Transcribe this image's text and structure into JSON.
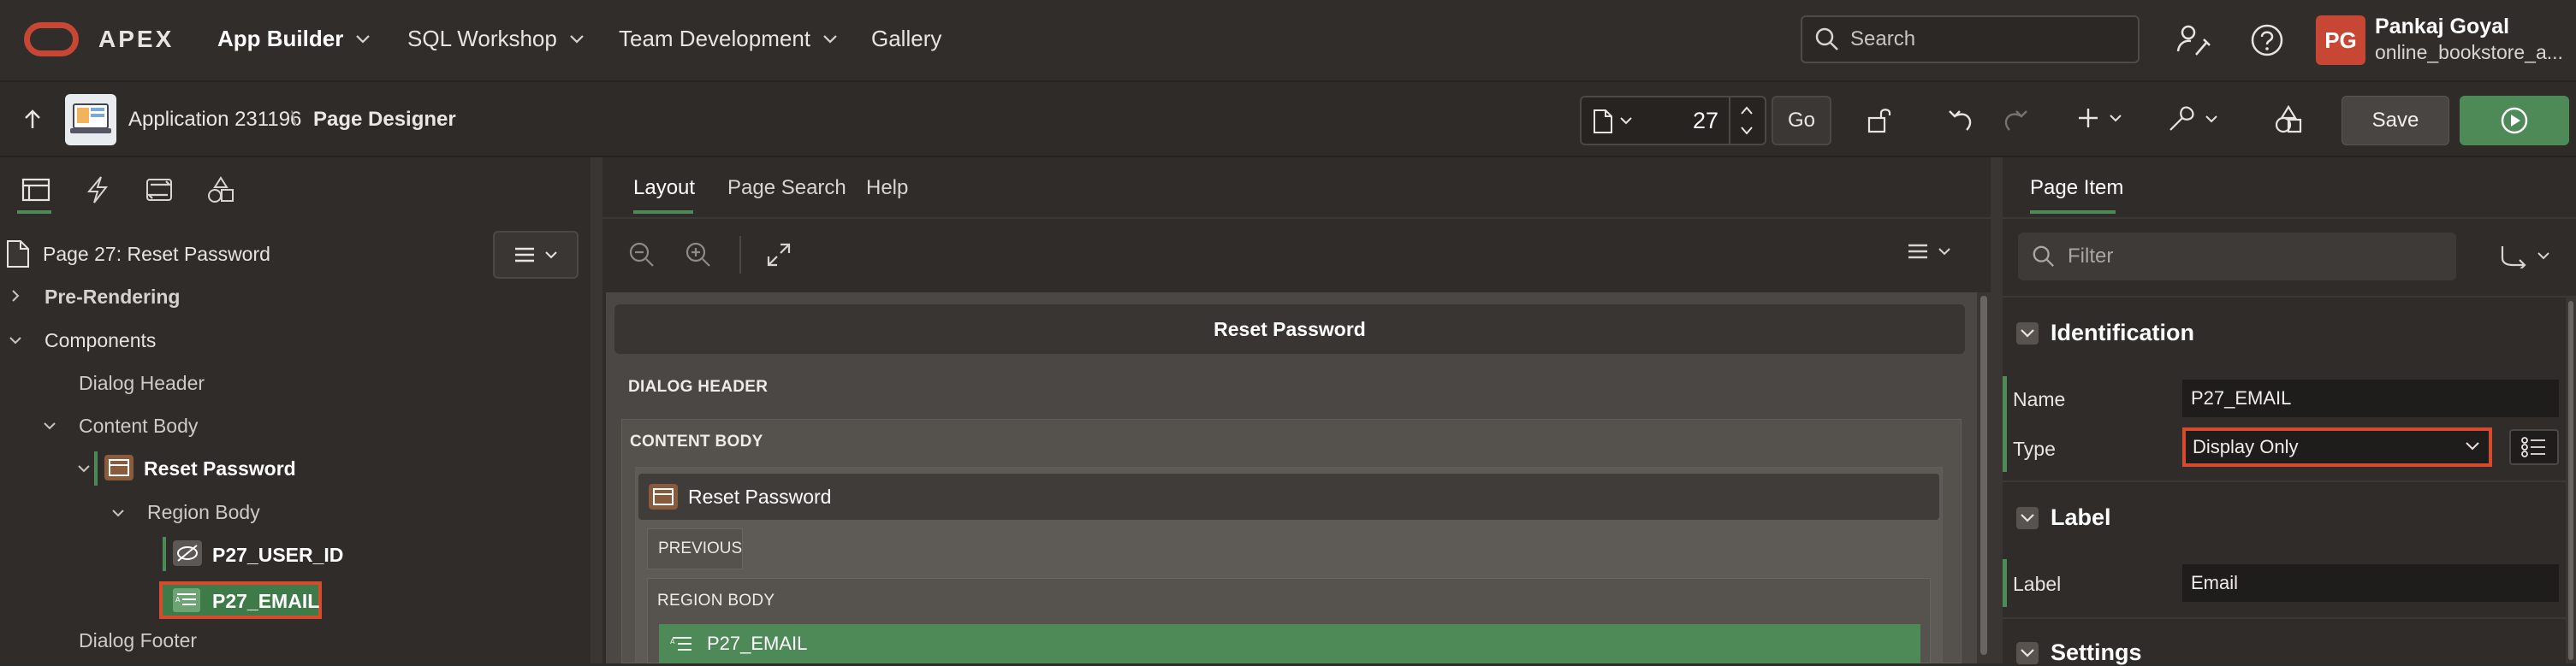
{
  "app": {
    "name": "APEX"
  },
  "nav": {
    "items": [
      "App Builder",
      "SQL Workshop",
      "Team Development",
      "Gallery"
    ]
  },
  "search": {
    "placeholder": "Search"
  },
  "user": {
    "initials": "PG",
    "name": "Pankaj Goyal",
    "workspace": "online_bookstore_a..."
  },
  "breadcrumb": {
    "application": "Application 231196",
    "separator": "\\",
    "page": "Page Designer"
  },
  "toolbar": {
    "page_number": "27",
    "go": "Go",
    "save": "Save"
  },
  "left_panel": {
    "page_title": "Page 27: Reset Password",
    "tree": [
      {
        "label": "Pre-Rendering",
        "bold": true
      },
      {
        "label": "Components"
      },
      {
        "label": "Dialog Header"
      },
      {
        "label": "Content Body"
      },
      {
        "label": "Reset Password",
        "bold": true
      },
      {
        "label": "Region Body"
      },
      {
        "label": "P27_USER_ID",
        "bold": true
      },
      {
        "label": "P27_EMAIL",
        "bold": true,
        "selected": true
      },
      {
        "label": "Dialog Footer"
      }
    ]
  },
  "center_panel": {
    "tabs": [
      "Layout",
      "Page Search",
      "Help"
    ],
    "active_tab": "Layout",
    "dialog_title": "Reset Password",
    "sections": [
      "DIALOG HEADER",
      "CONTENT BODY"
    ],
    "region_title": "Reset Password",
    "region_sections": [
      "PREVIOUS",
      "REGION BODY"
    ],
    "selected_item": "P27_EMAIL"
  },
  "right_panel": {
    "tab": "Page Item",
    "filter_placeholder": "Filter",
    "groups": {
      "identification": "Identification",
      "label": "Label",
      "settings": "Settings"
    },
    "fields": {
      "name_label": "Name",
      "name_value": "P27_EMAIL",
      "type_label": "Type",
      "type_value": "Display Only",
      "label_label": "Label",
      "label_value": "Email"
    }
  },
  "colors": {
    "accent": "#4e8a57",
    "brand": "#c74634",
    "highlight": "#d84a2e"
  }
}
